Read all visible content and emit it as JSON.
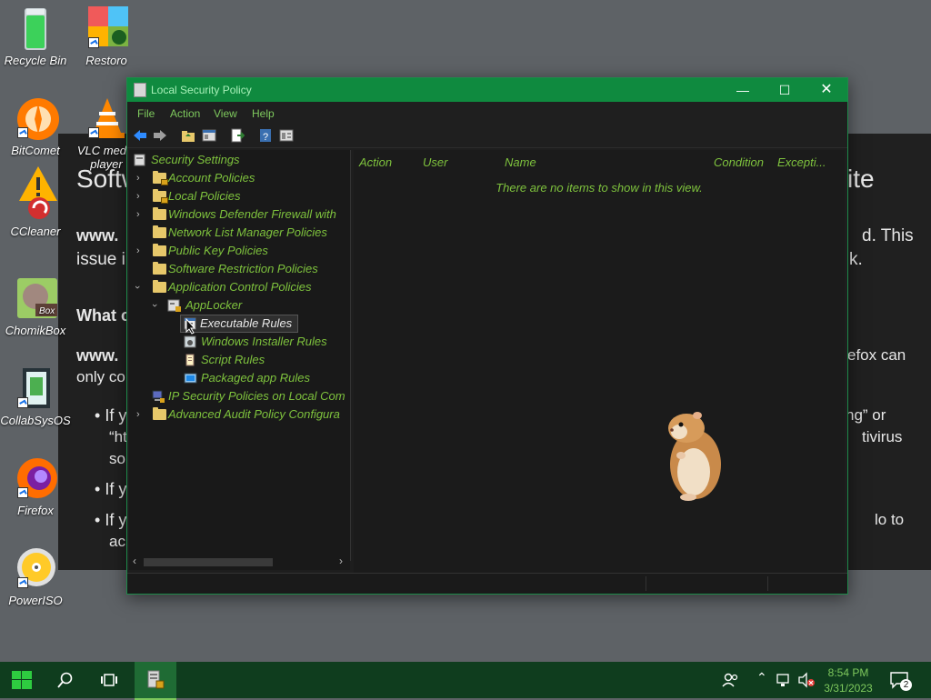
{
  "desktop": {
    "icons": [
      {
        "label": "Recycle Bin"
      },
      {
        "label": "Restoro"
      },
      {
        "label": "BitComet"
      },
      {
        "label": "VLC media player"
      },
      {
        "label": "CCleaner"
      },
      {
        "label": "ChomikBox"
      },
      {
        "label": "CollabSysOS"
      },
      {
        "label": "Firefox"
      },
      {
        "label": "PowerISO"
      }
    ]
  },
  "background_page": {
    "heading_left": "Softw",
    "heading_right": "ite",
    "bold_line1_left": "www.",
    "line1_right": "d. This",
    "line2_left": "issue i",
    "line2_right": "k.",
    "subheading_left": "What c",
    "bold_line2_left": "www.",
    "line3_right": "efox can",
    "line4_left": "only co",
    "bullet1_left": "If y",
    "bullet1_right": "ng” or",
    "bullet1_line2_left": "“ht",
    "bullet1_line2_right": "tivirus",
    "bullet1_line3_left": "so",
    "bullet2_left": "If y",
    "bullet3_left": "If y",
    "bullet3_right": "lo to",
    "bullet3_line2_left": "ac"
  },
  "window": {
    "title": "Local Security Policy",
    "menu": [
      "File",
      "Action",
      "View",
      "Help"
    ],
    "tree": {
      "root": "Security Settings",
      "items": [
        {
          "label": "Account Policies"
        },
        {
          "label": "Local Policies"
        },
        {
          "label": "Windows Defender Firewall with"
        },
        {
          "label": "Network List Manager Policies"
        },
        {
          "label": "Public Key Policies"
        },
        {
          "label": "Software Restriction Policies"
        },
        {
          "label": "Application Control Policies"
        },
        {
          "label": "AppLocker"
        },
        {
          "label": "Executable Rules"
        },
        {
          "label": "Windows Installer Rules"
        },
        {
          "label": "Script Rules"
        },
        {
          "label": "Packaged app Rules"
        },
        {
          "label": "IP Security Policies on Local Com"
        },
        {
          "label": "Advanced Audit Policy Configura"
        }
      ]
    },
    "list": {
      "columns": [
        "Action",
        "User",
        "Name",
        "Condition",
        "Excepti..."
      ],
      "empty_message": "There are no items to show in this view."
    }
  },
  "taskbar": {
    "time": "8:54 PM",
    "date": "3/31/2023",
    "notification_count": "2"
  },
  "colors": {
    "accent": "#0f8a3f",
    "text_green": "#7ec23d",
    "taskbar": "#0f3d1e"
  }
}
